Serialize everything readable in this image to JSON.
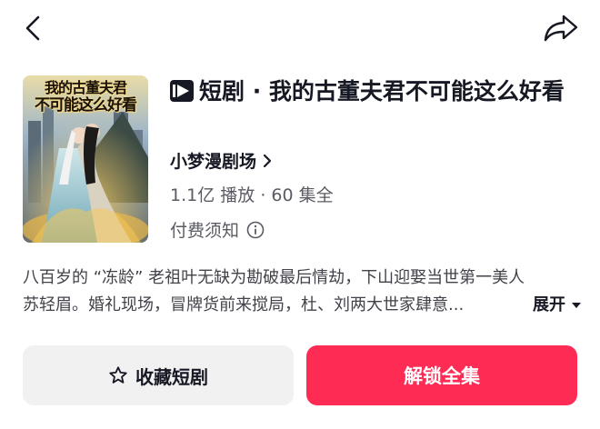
{
  "header": {
    "back_icon": "chevron-left-icon",
    "share_icon": "share-arrow-icon"
  },
  "drama": {
    "cover_title_line1": "我的古董夫君",
    "cover_title_line2": "不可能这么好看",
    "badge_icon": "short-drama-play-icon",
    "title": "短剧 · 我的古董夫君不可能这么好看",
    "producer": "小梦漫剧场",
    "plays": "1.1亿 播放",
    "separator": "·",
    "episodes": "60 集全",
    "notice": "付费须知"
  },
  "description": {
    "line1": "八百岁的 “冻龄” 老祖叶无缺为勘破最后情劫，下山迎娶当世第一美人",
    "line2": "苏轻眉。婚礼现场，冒牌货前来搅局，杜、刘两大世家肆意...",
    "expand_label": "展开"
  },
  "actions": {
    "collect_label": "收藏短剧",
    "unlock_label": "解锁全集"
  },
  "colors": {
    "accent": "#fe2c55",
    "secondary_button": "#f1f1f2",
    "text_primary": "#161823",
    "text_secondary": "#5a5b63"
  }
}
